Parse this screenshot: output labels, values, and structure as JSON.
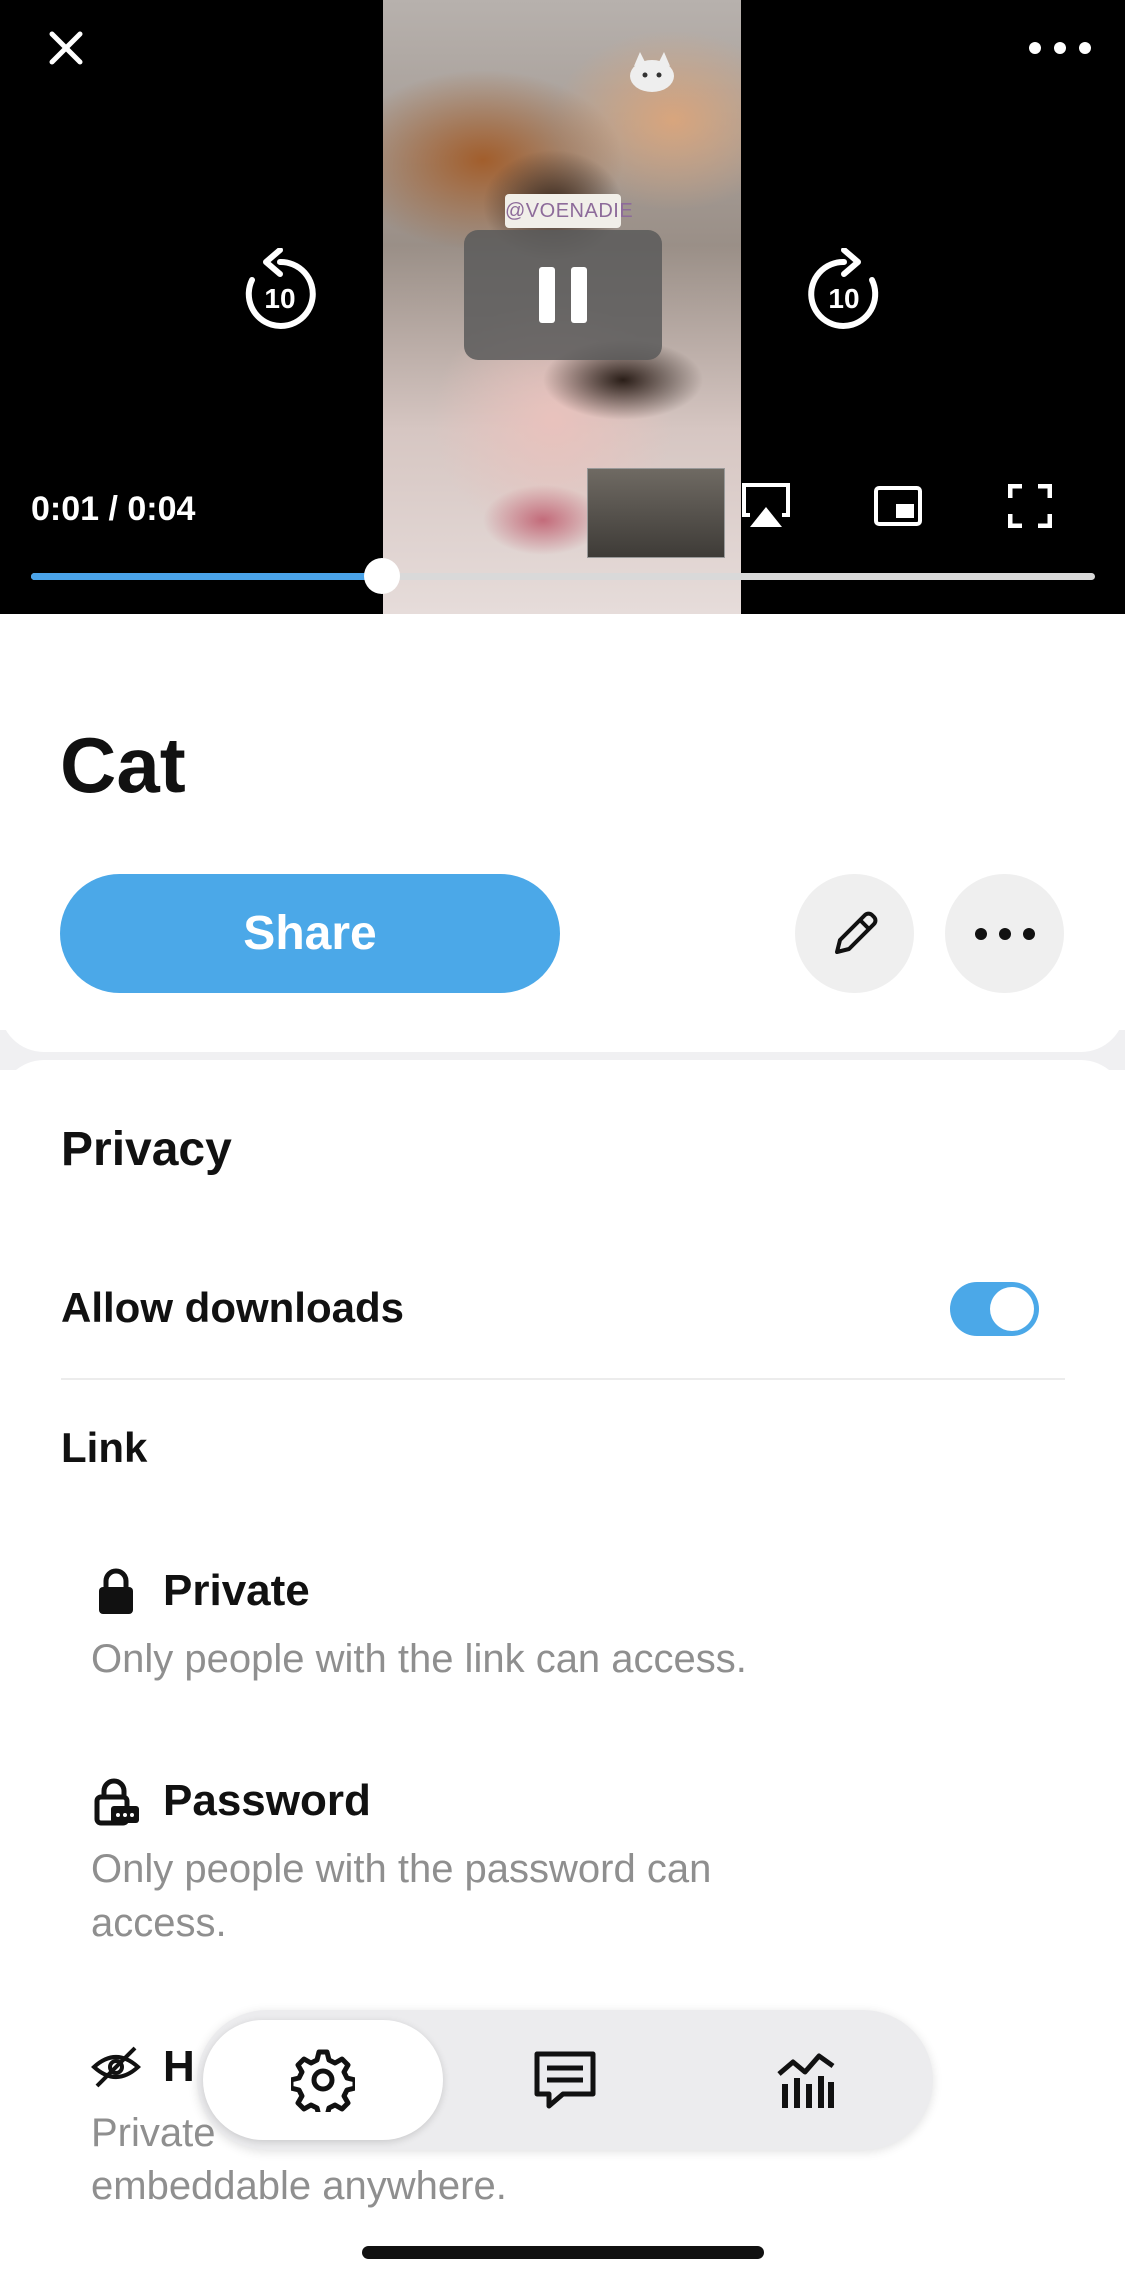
{
  "player": {
    "time_display": "0:01 / 0:04",
    "watermark_text": "@VOENADIE",
    "progress_fraction": 0.33,
    "rewind_label": "10",
    "forward_label": "10"
  },
  "video": {
    "title": "Cat",
    "share_label": "Share"
  },
  "privacy": {
    "heading": "Privacy",
    "allow_downloads_label": "Allow downloads",
    "allow_downloads_on": true,
    "link_heading": "Link",
    "options": [
      {
        "title": "Private",
        "description": "Only people with the link can access.",
        "icon": "lock-icon"
      },
      {
        "title": "Password",
        "description": "Only people with the password can access.",
        "icon": "password-lock-icon"
      },
      {
        "title": "H",
        "description": "Private … embeddable anywhere.",
        "icon": "eye-slash-icon"
      }
    ],
    "hidden_partial": {
      "title_visible": "H",
      "desc_line1_visible": "Private",
      "desc_line2_visible": "embeddable anywhere."
    }
  },
  "tabbar": {
    "tabs": [
      {
        "name": "settings",
        "icon": "gear-icon",
        "active": true
      },
      {
        "name": "comments",
        "icon": "comment-icon",
        "active": false
      },
      {
        "name": "analytics",
        "icon": "chart-icon",
        "active": false
      }
    ]
  },
  "colors": {
    "accent": "#4ba8e8",
    "muted_text": "#8f8f8f"
  }
}
